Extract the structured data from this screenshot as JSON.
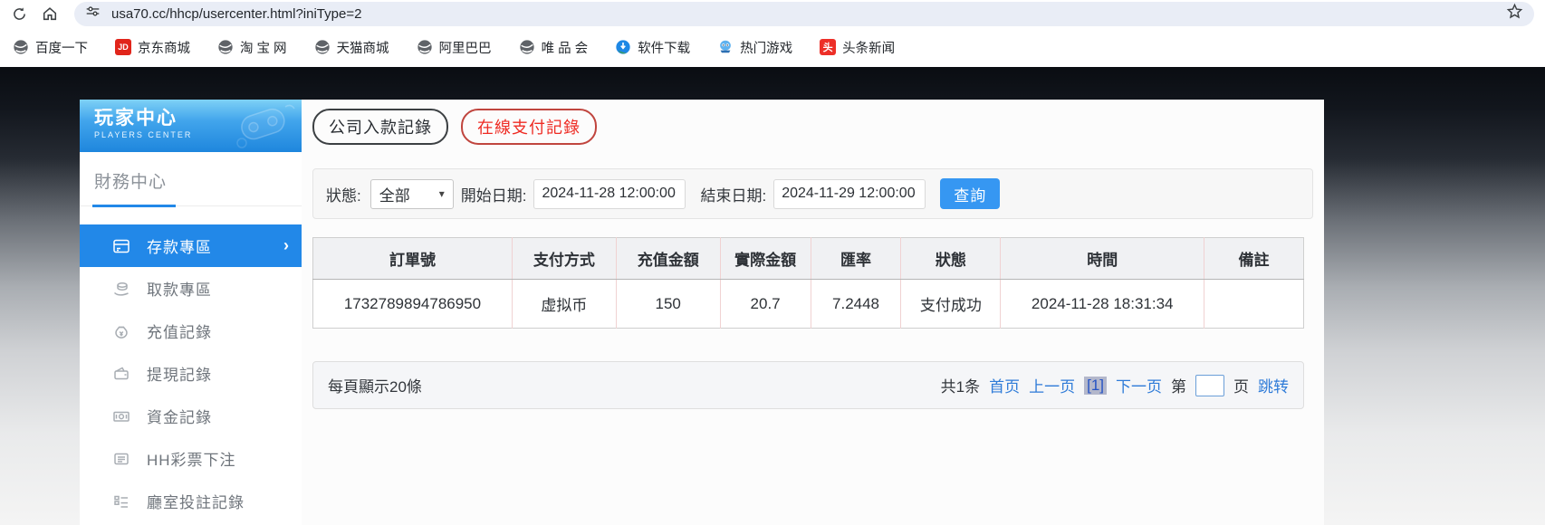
{
  "browser": {
    "url": "usa70.cc/hhcp/usercenter.html?iniType=2",
    "bookmarks": [
      {
        "label": "百度一下",
        "icon": "globe-icon"
      },
      {
        "label": "京东商城",
        "icon": "jd-icon",
        "badge": "JD"
      },
      {
        "label": "淘 宝 网",
        "icon": "globe-icon"
      },
      {
        "label": "天猫商城",
        "icon": "globe-icon"
      },
      {
        "label": "阿里巴巴",
        "icon": "globe-icon"
      },
      {
        "label": "唯 品 会",
        "icon": "globe-icon"
      },
      {
        "label": "软件下载",
        "icon": "software-download-icon"
      },
      {
        "label": "热门游戏",
        "icon": "game-mascot-icon"
      },
      {
        "label": "头条新闻",
        "icon": "toutiao-icon",
        "badge": "头"
      }
    ]
  },
  "sidebar": {
    "title": "玩家中心",
    "subtitle": "PLAYERS CENTER",
    "section": "財務中心",
    "items": [
      {
        "label": "存款專區",
        "icon": "deposit-card-icon",
        "active": true
      },
      {
        "label": "取款專區",
        "icon": "withdraw-hand-icon",
        "active": false
      },
      {
        "label": "充值記錄",
        "icon": "moneybag-icon",
        "active": false
      },
      {
        "label": "提現記錄",
        "icon": "wallet-icon",
        "active": false
      },
      {
        "label": "資金記錄",
        "icon": "banknote-icon",
        "active": false
      },
      {
        "label": "HH彩票下注",
        "icon": "ticket-list-icon",
        "active": false
      },
      {
        "label": "廳室投註記錄",
        "icon": "room-list-icon",
        "active": false
      }
    ]
  },
  "tabs": [
    {
      "label": "公司入款記錄",
      "active": false
    },
    {
      "label": "在線支付記錄",
      "active": true
    }
  ],
  "filter": {
    "status_label": "狀態:",
    "status_value": "全部",
    "start_label": "開始日期:",
    "start_value": "2024-11-28 12:00:00",
    "end_label": "結束日期:",
    "end_value": "2024-11-29 12:00:00",
    "query_label": "查詢"
  },
  "table": {
    "headers": [
      "訂單號",
      "支付方式",
      "充值金額",
      "實際金額",
      "匯率",
      "狀態",
      "時間",
      "備註"
    ],
    "rows": [
      [
        "1732789894786950",
        "虚拟币",
        "150",
        "20.7",
        "7.2448",
        "支付成功",
        "2024-11-28 18:31:34",
        ""
      ]
    ]
  },
  "pagination": {
    "page_size_text": "每頁顯示20條",
    "total_text": "共1条",
    "first_label": "首页",
    "prev_label": "上一页",
    "current_page": "[1]",
    "next_label": "下一页",
    "jump_prefix": "第",
    "jump_suffix": "页",
    "jump_label": "跳转"
  },
  "colors": {
    "sidebar_active_blue": "#2288e8",
    "header_gradient_top": "#7ed1f6",
    "header_gradient_bottom": "#1e86dd",
    "query_button_blue": "#3697f2",
    "link_blue": "#2e7bd8",
    "active_tab_red": "#ee2c24",
    "jd_red": "#e1251b",
    "toutiao_red": "#ed2f28",
    "table_divider_pink": "#f0d2d2"
  }
}
